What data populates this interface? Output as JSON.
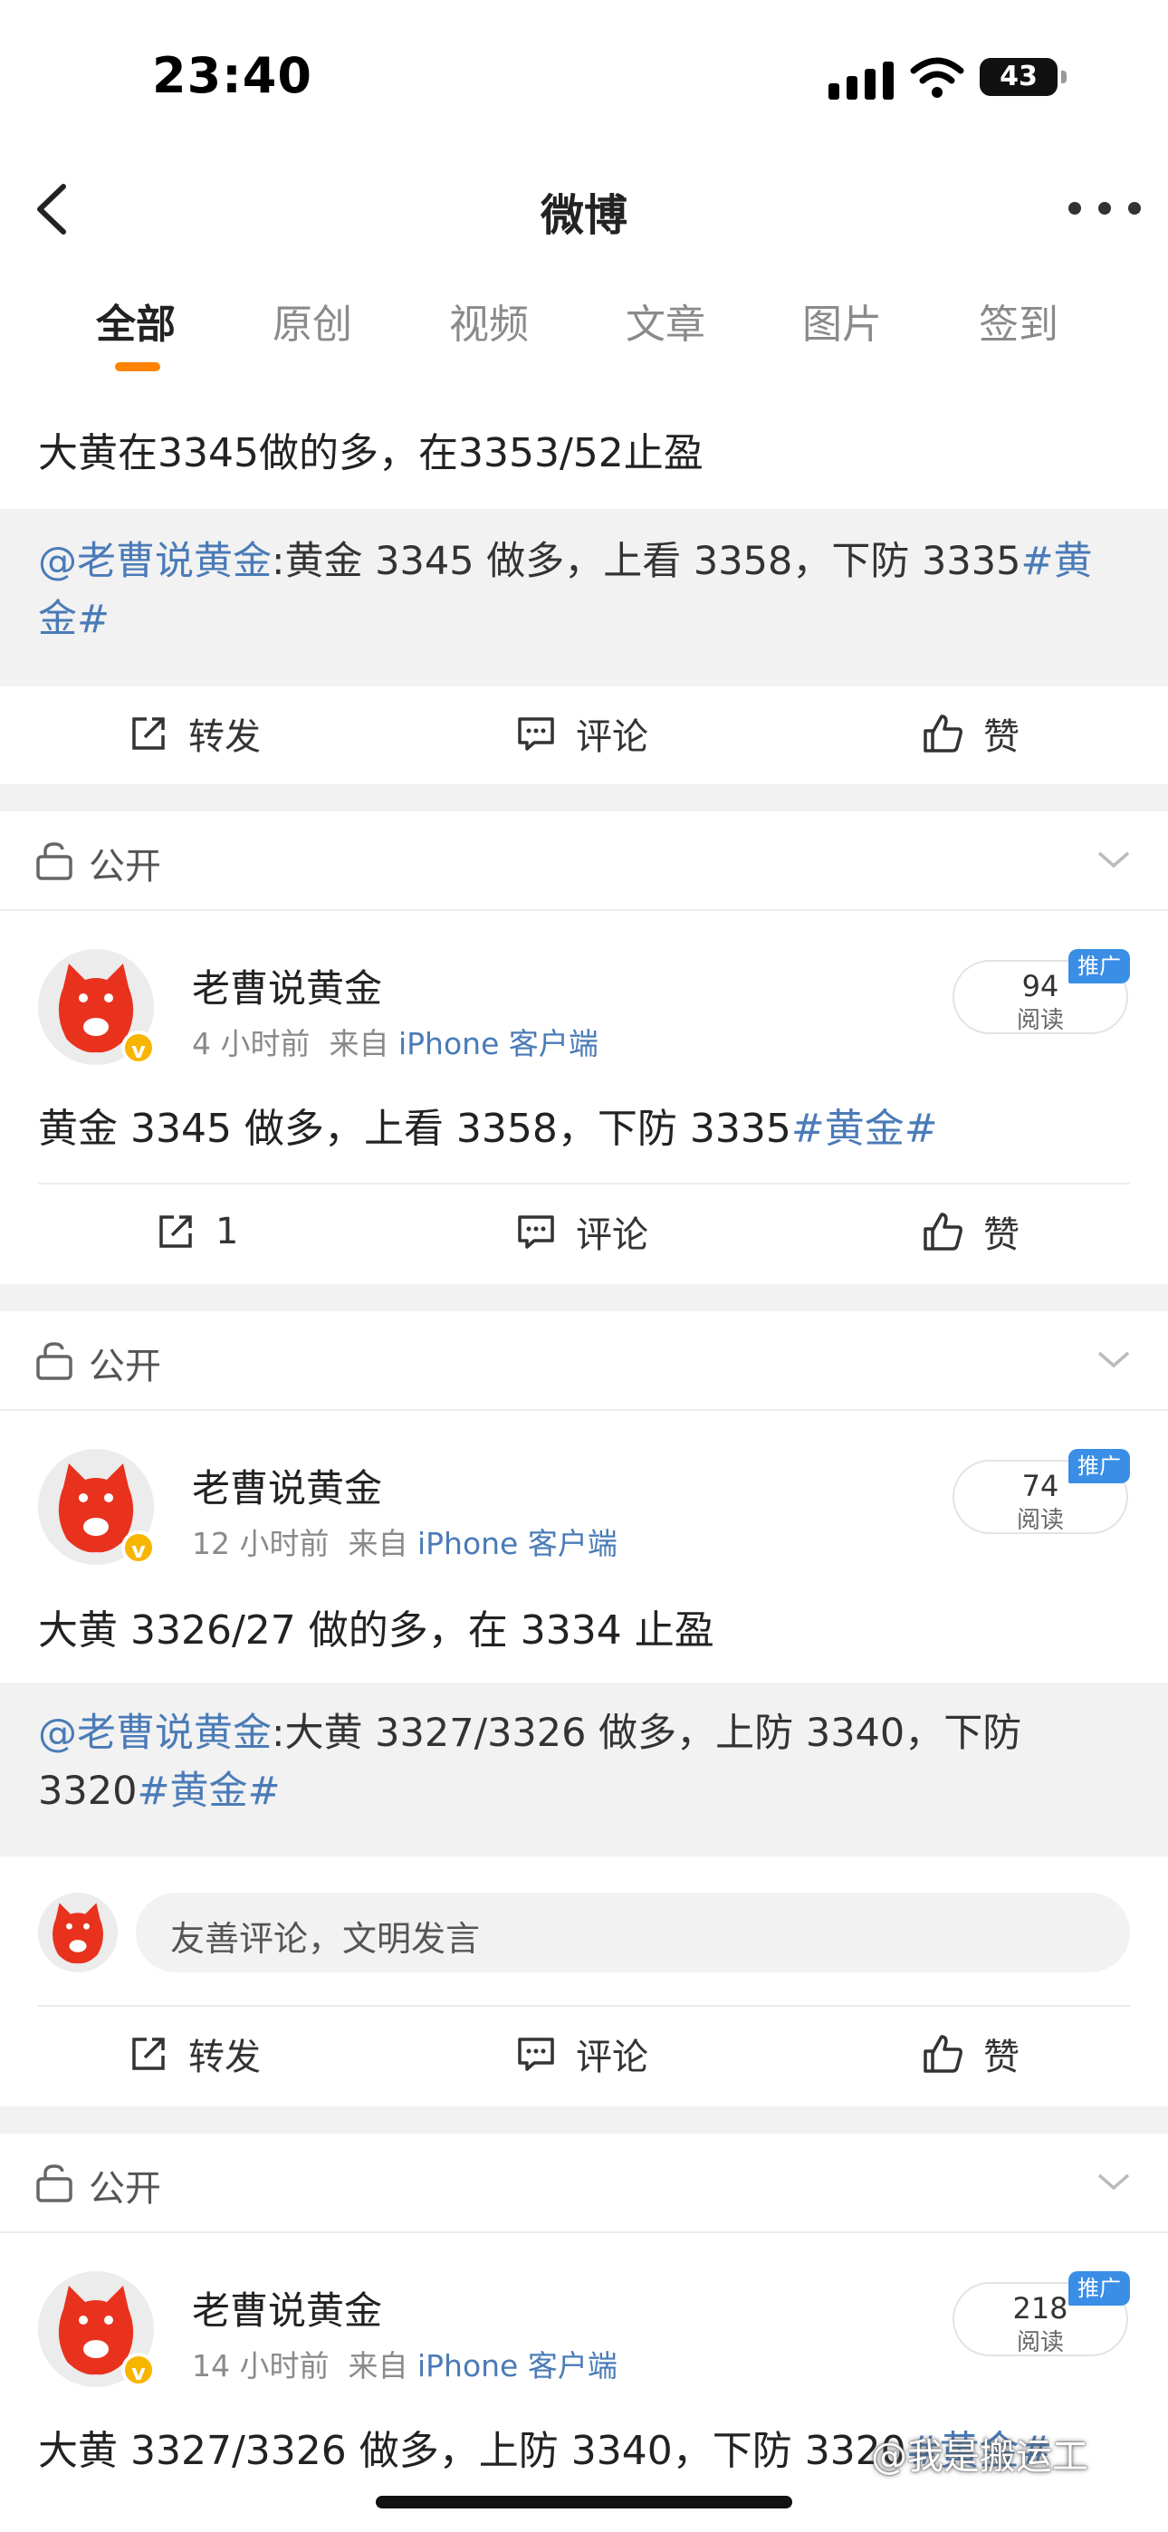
{
  "status_bar": {
    "time": "23:40",
    "battery": "43"
  },
  "nav": {
    "title": "微博"
  },
  "tabs": [
    {
      "label": "全部",
      "active": true
    },
    {
      "label": "原创"
    },
    {
      "label": "视频"
    },
    {
      "label": "文章"
    },
    {
      "label": "图片"
    },
    {
      "label": "签到"
    }
  ],
  "post0": {
    "text": "大黄在3345做的多，在3353/52止盈",
    "quote": {
      "mention": "@老曹说黄金",
      "text": ":黄金 3345 做多，上看 3358，下防 3335",
      "topic": "#黄金#"
    },
    "actions": {
      "repost": "转发",
      "comment": "评论",
      "like": "赞"
    }
  },
  "post1": {
    "visibility": "公开",
    "author": "老曹说黄金",
    "time": "4 小时前",
    "from_prefix": "来自",
    "source": "iPhone 客户端",
    "reads": "94",
    "reads_label": "阅读",
    "promo": "推广",
    "text": "黄金 3345 做多，上看 3358，下防 3335",
    "topic": "#黄金#",
    "actions": {
      "repost": "1",
      "comment": "评论",
      "like": "赞"
    }
  },
  "post2": {
    "visibility": "公开",
    "author": "老曹说黄金",
    "time": "12 小时前",
    "from_prefix": "来自",
    "source": "iPhone 客户端",
    "reads": "74",
    "reads_label": "阅读",
    "promo": "推广",
    "text": "大黄 3326/27 做的多，在 3334 止盈",
    "quote": {
      "mention": "@老曹说黄金",
      "text": ":大黄 3327/3326 做多，上防 3340，下防",
      "text2": "3320",
      "topic": "#黄金#"
    },
    "comment_placeholder": "友善评论，文明发言",
    "actions": {
      "repost": "转发",
      "comment": "评论",
      "like": "赞"
    }
  },
  "post3": {
    "visibility": "公开",
    "author": "老曹说黄金",
    "time": "14 小时前",
    "from_prefix": "来自",
    "source": "iPhone 客户端",
    "reads": "218",
    "reads_label": "阅读",
    "promo": "推广",
    "text": "大黄 3327/3326 做多，上防 3340，下防 3320",
    "topic": "#黄金#"
  },
  "watermark": "@我是搬运工",
  "colors": {
    "accent": "#ff8200",
    "link": "#4a7bb7",
    "promo": "#3a8ee6",
    "verified": "#f7b500",
    "avatar_red": "#e8321e"
  }
}
